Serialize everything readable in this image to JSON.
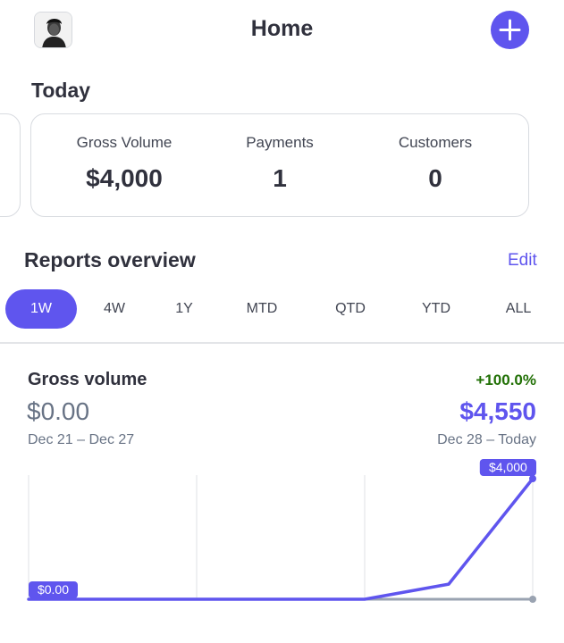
{
  "header": {
    "title": "Home",
    "avatar_icon": "avatar-icon",
    "add_icon": "plus-icon"
  },
  "today": {
    "section_title": "Today",
    "metrics": [
      {
        "label": "Gross Volume",
        "value": "$4,000"
      },
      {
        "label": "Payments",
        "value": "1"
      },
      {
        "label": "Customers",
        "value": "0"
      }
    ]
  },
  "reports": {
    "title": "Reports overview",
    "edit_label": "Edit",
    "tabs": [
      {
        "label": "1W",
        "active": true
      },
      {
        "label": "4W",
        "active": false
      },
      {
        "label": "1Y",
        "active": false
      },
      {
        "label": "MTD",
        "active": false
      },
      {
        "label": "QTD",
        "active": false
      },
      {
        "label": "YTD",
        "active": false
      },
      {
        "label": "ALL",
        "active": false
      }
    ]
  },
  "gross_volume": {
    "title": "Gross volume",
    "change": "+100.0%",
    "previous_value": "$0.00",
    "current_value": "$4,550",
    "previous_range": "Dec 21 – Dec 27",
    "current_range": "Dec 28 – Today"
  },
  "colors": {
    "accent": "#5f55ee",
    "positive": "#217005",
    "comparison_line": "#9aa3b1",
    "grid": "#dfe2e6"
  },
  "chart_data": {
    "type": "line",
    "x": [
      0,
      1,
      2,
      3,
      4,
      5,
      6
    ],
    "series": [
      {
        "values": [
          0,
          0,
          0,
          0,
          0,
          500,
          4000
        ],
        "color": "#5f55ee"
      },
      {
        "values": [
          0,
          0,
          0,
          0,
          0,
          0,
          0
        ],
        "color": "#9aa3b1"
      }
    ],
    "ylim": [
      0,
      4000
    ],
    "value_labels": {
      "start": "$0.00",
      "end": "$4,000"
    },
    "grid": "vertical"
  }
}
